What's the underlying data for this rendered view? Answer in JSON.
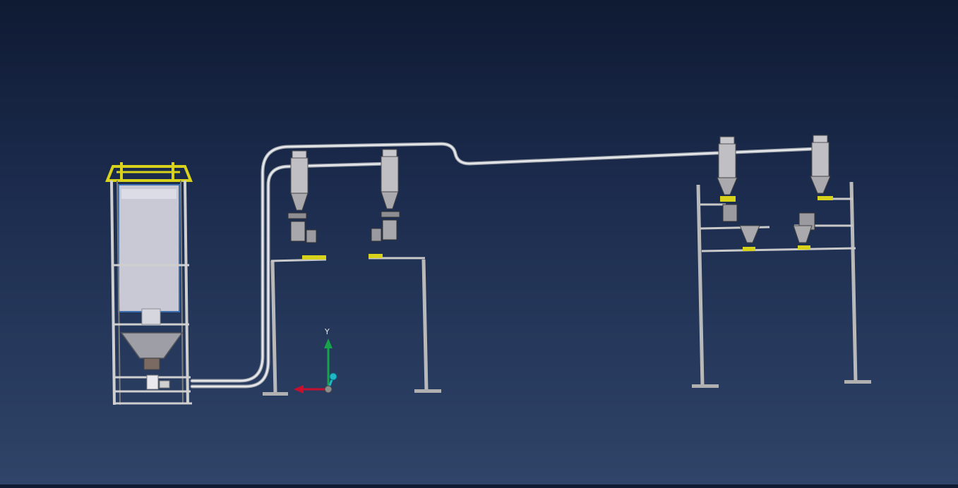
{
  "axis_triad": {
    "y_label": "Y",
    "x_color": "#c8102e",
    "y_color": "#16a34a",
    "z_color": "#1fb7c9"
  },
  "scene": {
    "background_top": "#0f1a33",
    "background_bottom": "#2f4468",
    "frame_color": "#c7c7c7",
    "highlight_color": "#d8d21a",
    "hopper_color": "#b7b7bf"
  },
  "equipment": {
    "big_bag_station": "big-bag-discharger",
    "receivers": [
      "vacuum-receiver-1",
      "vacuum-receiver-2",
      "vacuum-receiver-3",
      "vacuum-receiver-4"
    ],
    "stands": [
      "stand-left",
      "stand-right"
    ]
  }
}
